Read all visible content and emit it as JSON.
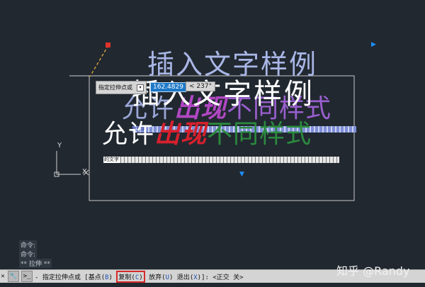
{
  "canvas": {
    "ghost_title": "插入文字样例",
    "ghost_line2": {
      "a": "允许",
      "b": "出现",
      "c": "不同样式"
    },
    "main_title": "插入文字样例",
    "main_line2": {
      "a": "允许",
      "b": "出现",
      "c": "不同样式"
    },
    "bar_blue_text": "的文字",
    "bar_white_text": "的文字",
    "ucs": {
      "y": "Y",
      "x": "X"
    },
    "colors": {
      "background": "#212830",
      "grip": "#e0322b",
      "accent_blue": "#1e90ff",
      "highlight_red": "#d52b2b"
    }
  },
  "tooltip": {
    "label": "指定拉伸点或",
    "value": "162.4829",
    "angle": "< 237°"
  },
  "history": [
    "命令:",
    "命令:",
    "** 拉伸 **"
  ],
  "command_line": {
    "prefix": "- 指定拉伸点或 [",
    "options": [
      {
        "label": "基点",
        "key": "B"
      },
      {
        "label": "复制",
        "key": "C"
      },
      {
        "label": "放弃",
        "key": "U"
      },
      {
        "label": "退出",
        "key": "X"
      }
    ],
    "suffix": "]:  <正交 关>"
  },
  "watermark": "知乎 @Randy"
}
